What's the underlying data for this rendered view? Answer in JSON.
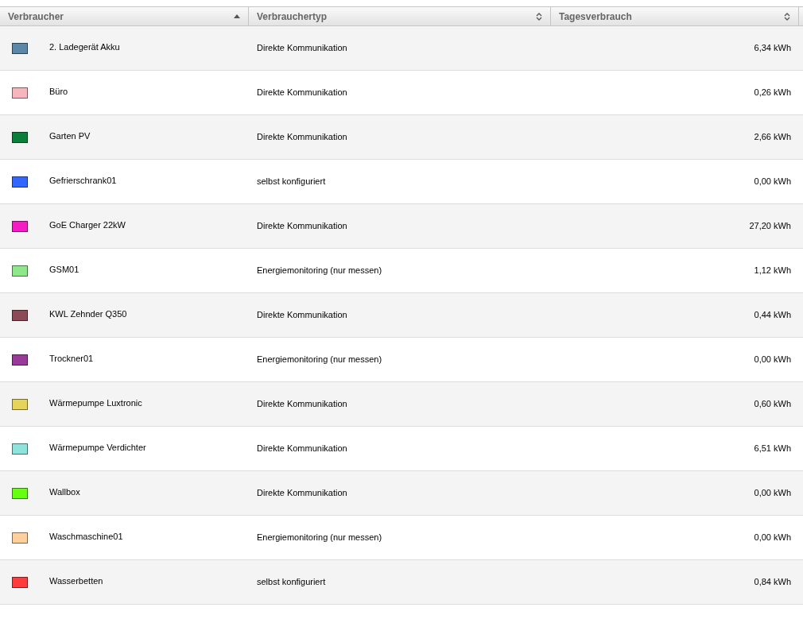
{
  "table": {
    "columns": [
      {
        "label": "Verbraucher",
        "sorted": true
      },
      {
        "label": "Verbrauchertyp",
        "sorted": false
      },
      {
        "label": "Tagesverbrauch",
        "sorted": false
      }
    ],
    "rows": [
      {
        "color": "#5b87a8",
        "name": "2. Ladegerät Akku",
        "type": "Direkte Kommunikation",
        "usage": "6,34 kWh"
      },
      {
        "color": "#f7b6bd",
        "name": "Büro",
        "type": "Direkte Kommunikation",
        "usage": "0,26 kWh"
      },
      {
        "color": "#0a7e3b",
        "name": "Garten PV",
        "type": "Direkte Kommunikation",
        "usage": "2,66 kWh"
      },
      {
        "color": "#3366ff",
        "name": "Gefrierschrank01",
        "type": "selbst konfiguriert",
        "usage": "0,00 kWh"
      },
      {
        "color": "#f51cc6",
        "name": "GoE Charger 22kW",
        "type": "Direkte Kommunikation",
        "usage": "27,20 kWh"
      },
      {
        "color": "#8ee88a",
        "name": "GSM01",
        "type": "Energiemonitoring (nur messen)",
        "usage": "1,12 kWh"
      },
      {
        "color": "#8b4a55",
        "name": "KWL Zehnder Q350",
        "type": "Direkte Kommunikation",
        "usage": "0,44 kWh"
      },
      {
        "color": "#99399a",
        "name": "Trockner01",
        "type": "Energiemonitoring (nur messen)",
        "usage": "0,00 kWh"
      },
      {
        "color": "#e6d45a",
        "name": "Wärmepumpe Luxtronic",
        "type": "Direkte Kommunikation",
        "usage": "0,60 kWh"
      },
      {
        "color": "#8ee3dd",
        "name": "Wärmepumpe Verdichter",
        "type": "Direkte Kommunikation",
        "usage": "6,51 kWh"
      },
      {
        "color": "#66ff11",
        "name": "Wallbox",
        "type": "Direkte Kommunikation",
        "usage": "0,00 kWh"
      },
      {
        "color": "#ffd09c",
        "name": "Waschmaschine01",
        "type": "Energiemonitoring (nur messen)",
        "usage": "0,00 kWh"
      },
      {
        "color": "#ff3c3c",
        "name": "Wasserbetten",
        "type": "selbst konfiguriert",
        "usage": "0,84 kWh"
      }
    ]
  }
}
